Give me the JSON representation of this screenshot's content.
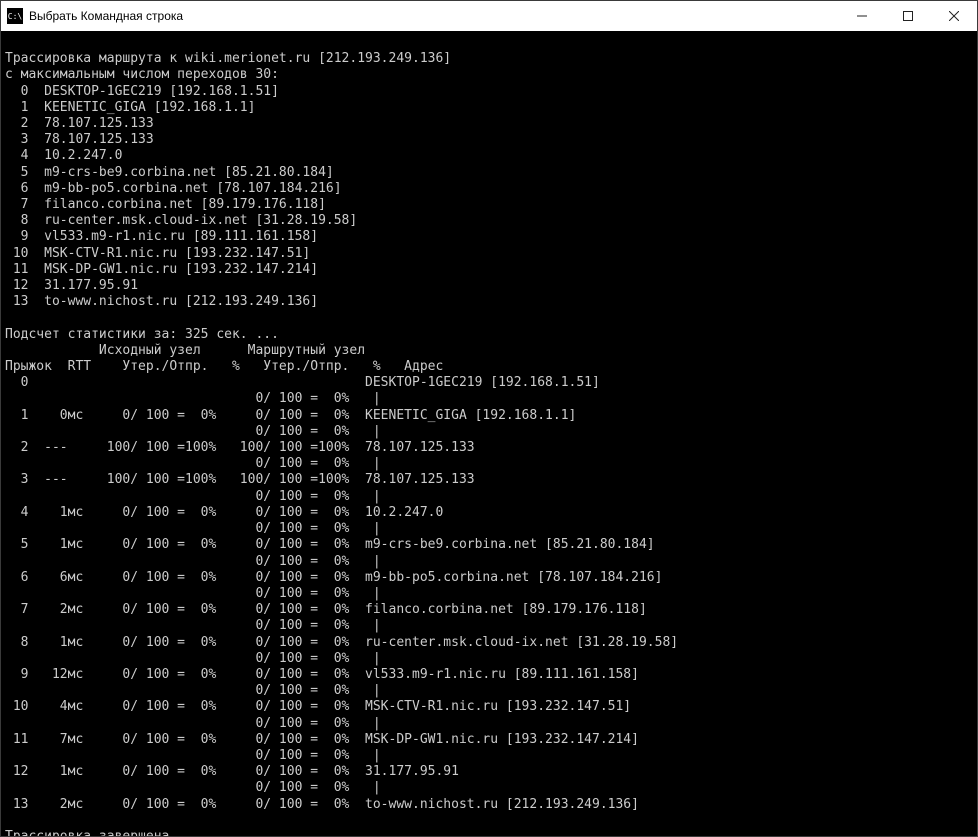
{
  "window": {
    "title": "Выбрать Командная строка"
  },
  "terminal": {
    "header1": "Трассировка маршрута к wiki.merionet.ru [212.193.249.136]",
    "header2": "с максимальным числом переходов 30:",
    "route": [
      "  0  DESKTOP-1GEC219 [192.168.1.51]",
      "  1  KEENETIC_GIGA [192.168.1.1]",
      "  2  78.107.125.133",
      "  3  78.107.125.133",
      "  4  10.2.247.0",
      "  5  m9-crs-be9.corbina.net [85.21.80.184]",
      "  6  m9-bb-po5.corbina.net [78.107.184.216]",
      "  7  filanco.corbina.net [89.179.176.118]",
      "  8  ru-center.msk.cloud-ix.net [31.28.19.58]",
      "  9  vl533.m9-r1.nic.ru [89.111.161.158]",
      " 10  MSK-CTV-R1.nic.ru [193.232.147.51]",
      " 11  MSK-DP-GW1.nic.ru [193.232.147.214]",
      " 12  31.177.95.91",
      " 13  to-www.nichost.ru [212.193.249.136]"
    ],
    "statsheader": "Подсчет статистики за: 325 сек. ...",
    "colhead1": "            Исходный узел      Маршрутный узел",
    "colhead2": "Прыжок  RTT    Утер./Отпр.   %   Утер./Отпр.   %   Адрес",
    "stats": [
      "  0                                           DESKTOP-1GEC219 [192.168.1.51]",
      "                                0/ 100 =  0%   |",
      "  1    0мс     0/ 100 =  0%     0/ 100 =  0%  KEENETIC_GIGA [192.168.1.1]",
      "                                0/ 100 =  0%   |",
      "  2  ---     100/ 100 =100%   100/ 100 =100%  78.107.125.133",
      "                                0/ 100 =  0%   |",
      "  3  ---     100/ 100 =100%   100/ 100 =100%  78.107.125.133",
      "                                0/ 100 =  0%   |",
      "  4    1мс     0/ 100 =  0%     0/ 100 =  0%  10.2.247.0",
      "                                0/ 100 =  0%   |",
      "  5    1мс     0/ 100 =  0%     0/ 100 =  0%  m9-crs-be9.corbina.net [85.21.80.184]",
      "                                0/ 100 =  0%   |",
      "  6    6мс     0/ 100 =  0%     0/ 100 =  0%  m9-bb-po5.corbina.net [78.107.184.216]",
      "                                0/ 100 =  0%   |",
      "  7    2мс     0/ 100 =  0%     0/ 100 =  0%  filanco.corbina.net [89.179.176.118]",
      "                                0/ 100 =  0%   |",
      "  8    1мс     0/ 100 =  0%     0/ 100 =  0%  ru-center.msk.cloud-ix.net [31.28.19.58]",
      "                                0/ 100 =  0%   |",
      "  9   12мс     0/ 100 =  0%     0/ 100 =  0%  vl533.m9-r1.nic.ru [89.111.161.158]",
      "                                0/ 100 =  0%   |",
      " 10    4мс     0/ 100 =  0%     0/ 100 =  0%  MSK-CTV-R1.nic.ru [193.232.147.51]",
      "                                0/ 100 =  0%   |",
      " 11    7мс     0/ 100 =  0%     0/ 100 =  0%  MSK-DP-GW1.nic.ru [193.232.147.214]",
      "                                0/ 100 =  0%   |",
      " 12    1мс     0/ 100 =  0%     0/ 100 =  0%  31.177.95.91",
      "                                0/ 100 =  0%   |",
      " 13    2мс     0/ 100 =  0%     0/ 100 =  0%  to-www.nichost.ru [212.193.249.136]"
    ],
    "footer": "Трассировка завершена."
  }
}
